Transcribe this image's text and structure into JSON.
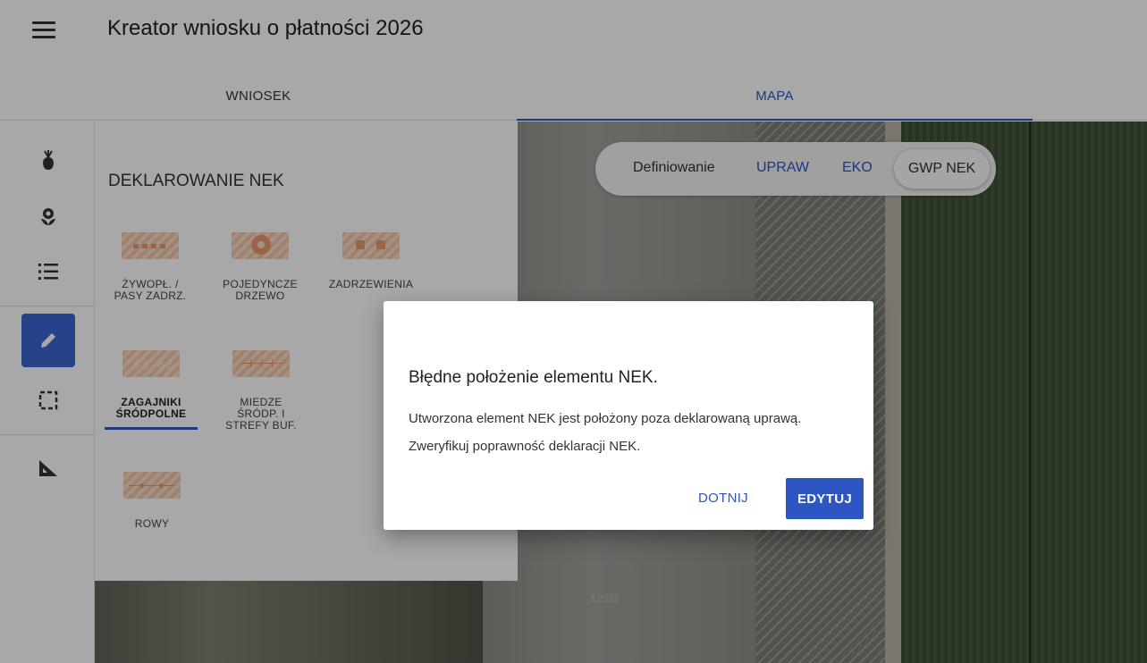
{
  "app": {
    "title": "Kreator wniosku o płatności 2026"
  },
  "tabs": [
    {
      "label": "WNIOSEK",
      "active": false
    },
    {
      "label": "MAPA",
      "active": true
    }
  ],
  "rail": {
    "icons": [
      "crop-icon",
      "flower-icon",
      "list-icon",
      "pencil-icon",
      "select-area-icon",
      "measure-icon"
    ],
    "active": "pencil-icon"
  },
  "panel": {
    "title": "DEKLAROWANIE NEK",
    "tools": [
      {
        "label_1": "ŻYWOPŁ. /",
        "label_2": "PASY ZADRZ."
      },
      {
        "label_1": "POJEDYNCZE",
        "label_2": "DRZEWO"
      },
      {
        "label_1": "ZADRZEWIENIA"
      },
      {
        "label_1": "ZAGAJNIKI",
        "label_2": "ŚRÓDPOLNE",
        "selected": true
      },
      {
        "label_1": "MIEDZE",
        "label_2": "ŚRÓDP. I",
        "label_3": "STREFY BUF."
      },
      {
        "label_1": "ROWY"
      }
    ]
  },
  "map_toggle": {
    "label": "Definiowanie",
    "options": [
      "UPRAW",
      "EKO",
      "GWP NEK"
    ],
    "selected": "GWP NEK"
  },
  "map": {
    "parcel_label": "121/2"
  },
  "dialog": {
    "title": "Błędne położenie elementu NEK.",
    "message_1": "Utworzona element NEK jest położony poza deklarowaną uprawą.",
    "message_2": "Zweryfikuj poprawność deklaracji NEK.",
    "button_secondary": "DOTNIJ",
    "button_primary": "EDYTUJ"
  },
  "colors": {
    "accent": "#2d56c2",
    "tool_icon": "#f2c4a5"
  }
}
